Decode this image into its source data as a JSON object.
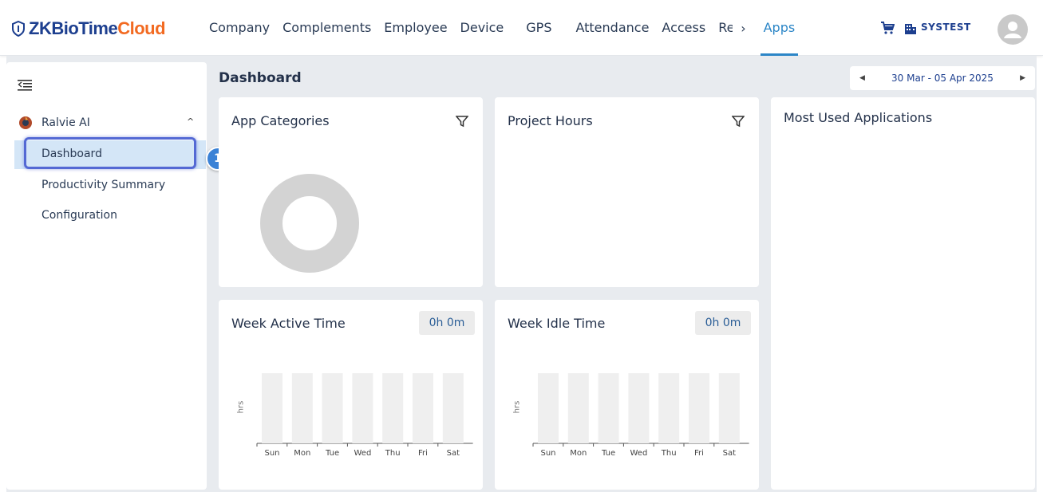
{
  "brand": {
    "logo_text_main": "ZKBioTime",
    "logo_text_accent": "Cloud"
  },
  "nav": {
    "items": [
      {
        "label": "Company"
      },
      {
        "label": "Complements"
      },
      {
        "label": "Employee"
      },
      {
        "label": "Device"
      },
      {
        "label": "GPS"
      },
      {
        "label": "Attendance"
      },
      {
        "label": "Access"
      },
      {
        "label": "Re"
      }
    ],
    "more_arrow": "›",
    "active": "Apps",
    "tenant": "SYSTEST"
  },
  "sidebar": {
    "group_label": "Ralvie AI",
    "group_chevron": "^",
    "items": [
      {
        "label": "Dashboard",
        "selected": true
      },
      {
        "label": "Productivity Summary"
      },
      {
        "label": "Configuration"
      }
    ],
    "step_badge": "1"
  },
  "main": {
    "title": "Dashboard",
    "date_range": "30 Mar - 05 Apr 2025",
    "prev": "◀",
    "next": "▶"
  },
  "cards": {
    "app_categories": {
      "title": "App Categories"
    },
    "project_hours": {
      "title": "Project Hours"
    },
    "most_used": {
      "title": "Most Used Applications"
    },
    "week_active": {
      "title": "Week Active Time",
      "badge": "0h 0m",
      "axis_label": "hrs"
    },
    "week_idle": {
      "title": "Week Idle Time",
      "badge": "0h 0m",
      "axis_label": "hrs"
    }
  },
  "chart_data": [
    {
      "type": "bar",
      "title": "Week Active Time",
      "ylabel": "hrs",
      "categories": [
        "Sun",
        "Mon",
        "Tue",
        "Wed",
        "Thu",
        "Fri",
        "Sat"
      ],
      "values": [
        0,
        0,
        0,
        0,
        0,
        0,
        0
      ]
    },
    {
      "type": "bar",
      "title": "Week Idle Time",
      "ylabel": "hrs",
      "categories": [
        "Sun",
        "Mon",
        "Tue",
        "Wed",
        "Thu",
        "Fri",
        "Sat"
      ],
      "values": [
        0,
        0,
        0,
        0,
        0,
        0,
        0
      ]
    }
  ],
  "colors": {
    "accent": "#2c86c7",
    "brand": "#1d3f8f",
    "brand_accent": "#f26a21",
    "highlight": "#5469d4"
  }
}
